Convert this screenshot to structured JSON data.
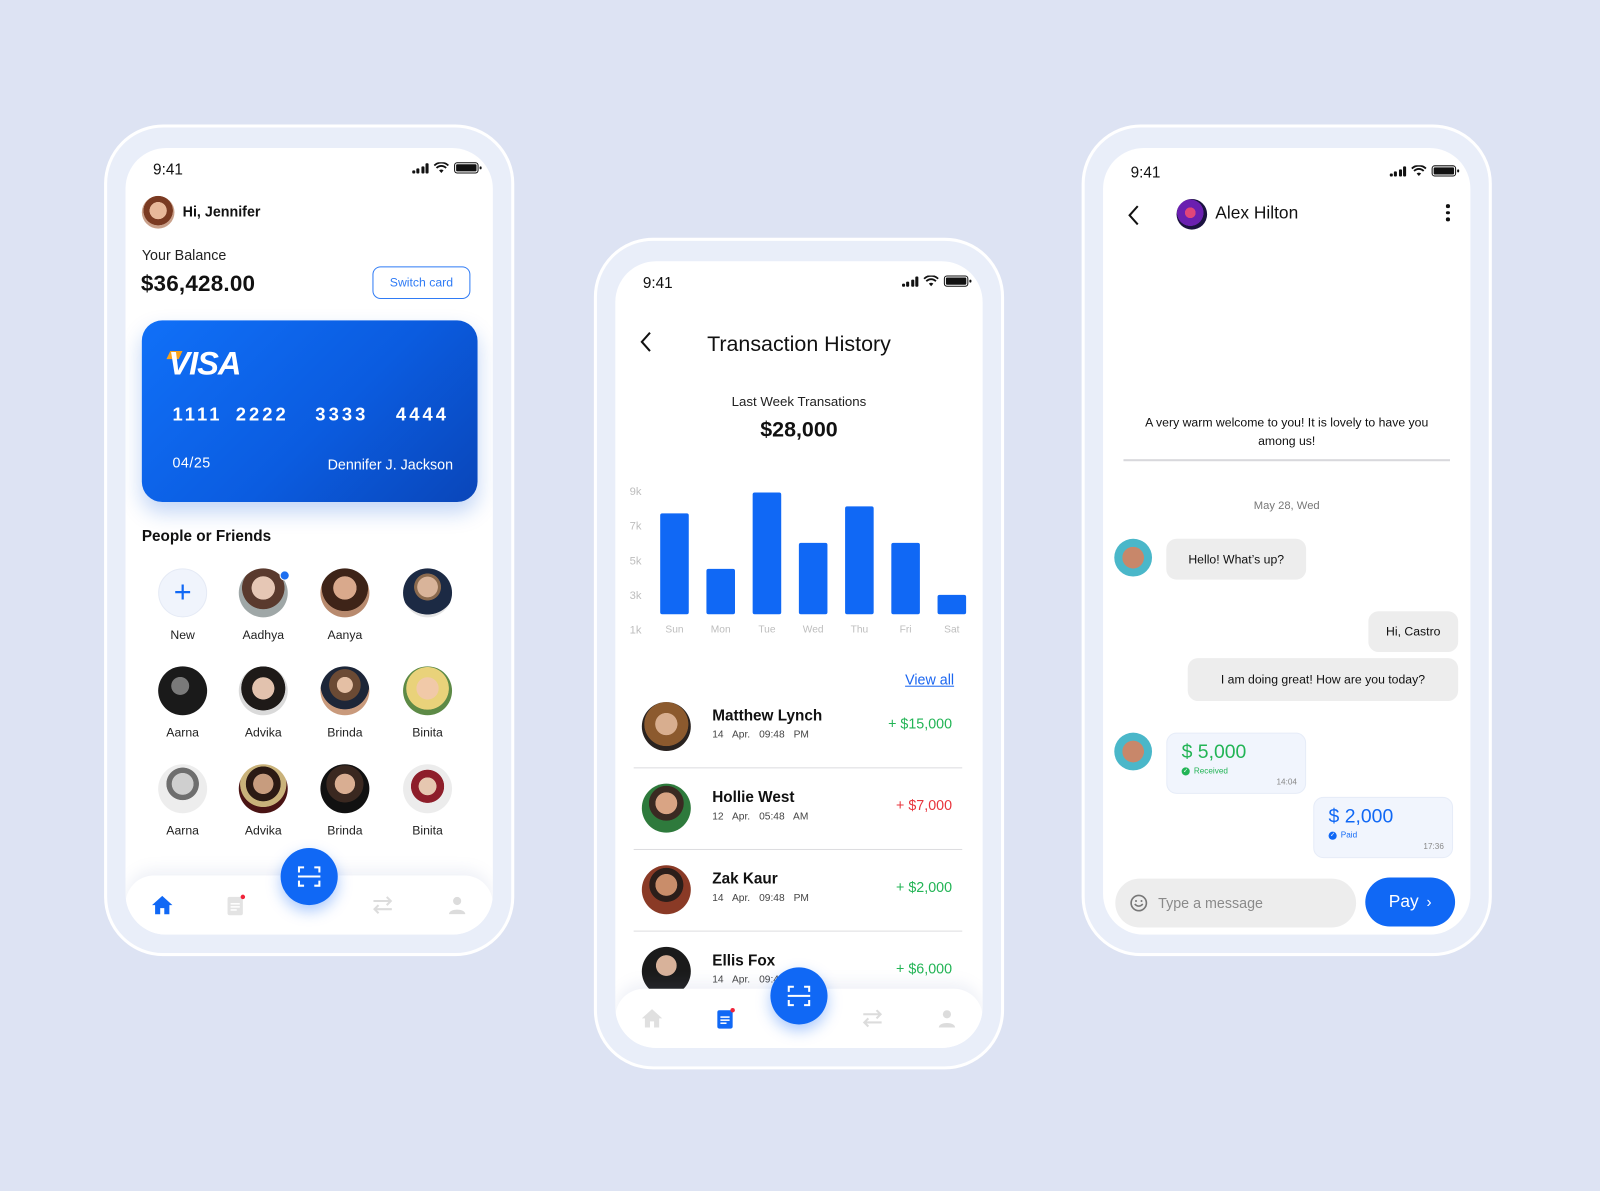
{
  "colors": {
    "background": "#DDE3F3",
    "accent": "#1068F5",
    "positive": "#22B455",
    "negative": "#E8343C"
  },
  "status_bar": {
    "time": "9:41"
  },
  "home": {
    "greeting": "Hi, Jennifer",
    "balance_label": "Your Balance",
    "balance": "$36,428.00",
    "switch_card_label": "Switch card",
    "card": {
      "brand": "VISA",
      "number_groups": [
        "1111",
        "2222",
        "3333",
        "4444"
      ],
      "expiry": "04/25",
      "holder": "Dennifer J. Jackson"
    },
    "friends_title": "People or Friends",
    "friends": [
      {
        "name": "New",
        "type": "add"
      },
      {
        "name": "Aadhya",
        "online": true
      },
      {
        "name": "Aanya"
      },
      {
        "name": ""
      },
      {
        "name": "Aarna"
      },
      {
        "name": "Advika"
      },
      {
        "name": "Brinda"
      },
      {
        "name": "Binita"
      },
      {
        "name": "Aarna"
      },
      {
        "name": "Advika"
      },
      {
        "name": "Brinda"
      },
      {
        "name": "Binita"
      }
    ],
    "active_nav": "home"
  },
  "history": {
    "title": "Transaction History",
    "summary_label": "Last Week Transations",
    "summary_value": "$28,000",
    "view_all_label": "View all",
    "transactions": [
      {
        "name": "Matthew Lynch",
        "date": "14 Apr.",
        "time": "09:48 PM",
        "amount": "+ $15,000",
        "direction": "positive"
      },
      {
        "name": "Hollie West",
        "date": "12 Apr.",
        "time": "05:48 AM",
        "amount": "+ $7,000",
        "direction": "negative"
      },
      {
        "name": "Zak Kaur",
        "date": "14 Apr.",
        "time": "09:48 PM",
        "amount": "+ $2,000",
        "direction": "positive"
      },
      {
        "name": "Ellis Fox",
        "date": "14 Apr.",
        "time": "09:48 PM",
        "amount": "+ $6,000",
        "direction": "positive"
      }
    ],
    "active_nav": "history"
  },
  "chart_data": {
    "type": "bar",
    "title": "Last Week Transations",
    "xlabel": "",
    "ylabel": "",
    "categories": [
      "Sun",
      "Mon",
      "Tue",
      "Wed",
      "Thu",
      "Fri",
      "Sat"
    ],
    "values": [
      7700,
      4500,
      8900,
      6000,
      8100,
      6000,
      3000
    ],
    "y_ticks": [
      "9k",
      "7k",
      "5k",
      "3k",
      "1k"
    ],
    "y_tick_values": [
      9000,
      7000,
      5000,
      3000,
      1000
    ],
    "ylim": [
      1000,
      9000
    ],
    "grid": false,
    "legend": "none",
    "bar_color": "#1068F5"
  },
  "chat": {
    "contact_name": "Alex Hilton",
    "welcome_text": "A very warm welcome to you! It is lovely to have you among us!",
    "date_separator": "May 28, Wed",
    "messages": [
      {
        "from": "them",
        "text": "Hello! What’s up?"
      },
      {
        "from": "me",
        "text": "Hi, Castro"
      },
      {
        "from": "me",
        "text": "I am doing great! How are you today?"
      }
    ],
    "payments": [
      {
        "from": "them",
        "amount": "$ 5,000",
        "status": "Received",
        "time": "14:04"
      },
      {
        "from": "me",
        "amount": "$ 2,000",
        "status": "Paid",
        "time": "17:36"
      }
    ],
    "input_placeholder": "Type a message",
    "input_value": "",
    "pay_label": "Pay"
  }
}
